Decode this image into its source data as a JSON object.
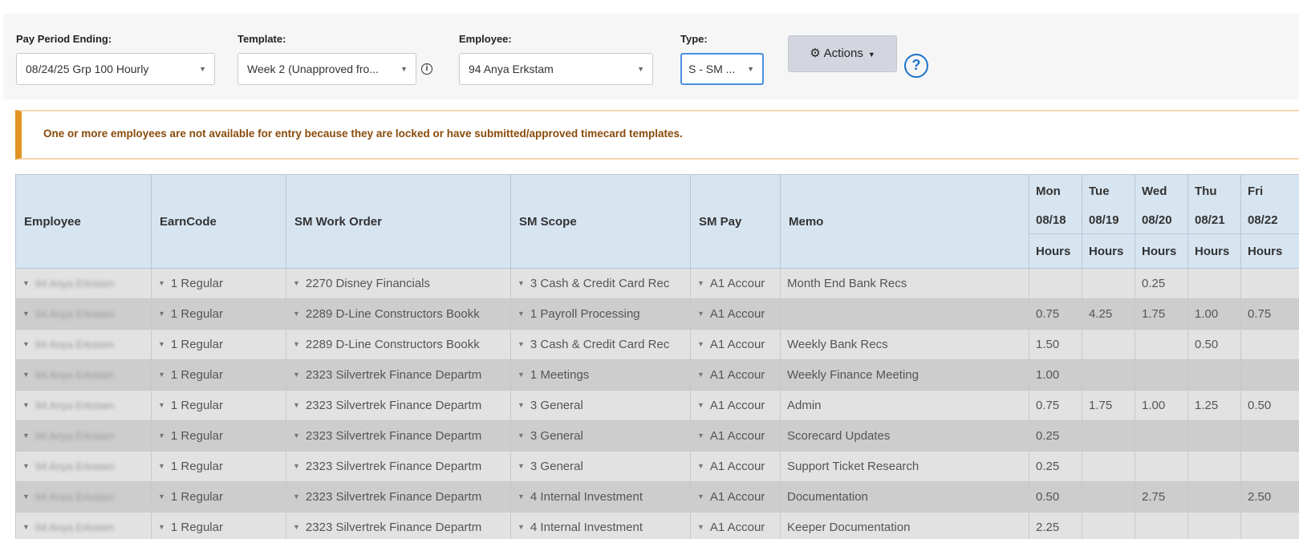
{
  "filters": {
    "pay_period": {
      "label": "Pay Period Ending:",
      "value": "08/24/25 Grp 100 Hourly"
    },
    "template": {
      "label": "Template:",
      "value": "Week 2 (Unapproved fro..."
    },
    "employee": {
      "label": "Employee:",
      "value": "94 Anya Erkstam"
    },
    "type": {
      "label": "Type:",
      "value": "S - SM ..."
    },
    "actions_label": "Actions",
    "help_icon": "help-circle-icon",
    "info_icon": "info-circle-icon"
  },
  "alert": {
    "message": "One or more employees are not available for entry because they are locked or have submitted/approved timecard templates.",
    "accent_color": "#e39321"
  },
  "grid": {
    "headers": {
      "employee": "Employee",
      "earncode": "EarnCode",
      "work_order": "SM Work Order",
      "scope": "SM Scope",
      "pay": "SM Pay",
      "memo": "Memo",
      "hours": "Hours"
    },
    "days": [
      {
        "day": "Mon",
        "date": "08/18"
      },
      {
        "day": "Tue",
        "date": "08/19"
      },
      {
        "day": "Wed",
        "date": "08/20"
      },
      {
        "day": "Thu",
        "date": "08/21"
      },
      {
        "day": "Fri",
        "date": "08/22"
      }
    ],
    "rows": [
      {
        "employee": "94 Anya Erkstam",
        "earncode": "1 Regular",
        "work_order": "2270 Disney Financials",
        "scope": "3 Cash & Credit Card Rec",
        "pay": "A1 Accour",
        "memo": "Month End Bank Recs",
        "hours": [
          "",
          "",
          "0.25",
          "",
          ""
        ]
      },
      {
        "employee": "94 Anya Erkstam",
        "earncode": "1 Regular",
        "work_order": "2289 D-Line Constructors Bookk",
        "scope": "1 Payroll Processing",
        "pay": "A1 Accour",
        "memo": "",
        "hours": [
          "0.75",
          "4.25",
          "1.75",
          "1.00",
          "0.75"
        ]
      },
      {
        "employee": "94 Anya Erkstam",
        "earncode": "1 Regular",
        "work_order": "2289 D-Line Constructors Bookk",
        "scope": "3 Cash & Credit Card Rec",
        "pay": "A1 Accour",
        "memo": "Weekly Bank Recs",
        "hours": [
          "1.50",
          "",
          "",
          "0.50",
          ""
        ]
      },
      {
        "employee": "94 Anya Erkstam",
        "earncode": "1 Regular",
        "work_order": "2323 Silvertrek Finance Departm",
        "scope": "1 Meetings",
        "pay": "A1 Accour",
        "memo": "Weekly Finance Meeting",
        "hours": [
          "1.00",
          "",
          "",
          "",
          ""
        ]
      },
      {
        "employee": "94 Anya Erkstam",
        "earncode": "1 Regular",
        "work_order": "2323 Silvertrek Finance Departm",
        "scope": "3 General",
        "pay": "A1 Accour",
        "memo": "Admin",
        "hours": [
          "0.75",
          "1.75",
          "1.00",
          "1.25",
          "0.50"
        ]
      },
      {
        "employee": "94 Anya Erkstam",
        "earncode": "1 Regular",
        "work_order": "2323 Silvertrek Finance Departm",
        "scope": "3 General",
        "pay": "A1 Accour",
        "memo": "Scorecard Updates",
        "hours": [
          "0.25",
          "",
          "",
          "",
          ""
        ]
      },
      {
        "employee": "94 Anya Erkstam",
        "earncode": "1 Regular",
        "work_order": "2323 Silvertrek Finance Departm",
        "scope": "3 General",
        "pay": "A1 Accour",
        "memo": "Support Ticket Research",
        "hours": [
          "0.25",
          "",
          "",
          "",
          ""
        ]
      },
      {
        "employee": "94 Anya Erkstam",
        "earncode": "1 Regular",
        "work_order": "2323 Silvertrek Finance Departm",
        "scope": "4 Internal Investment",
        "pay": "A1 Accour",
        "memo": "Documentation",
        "hours": [
          "0.50",
          "",
          "2.75",
          "",
          "2.50"
        ]
      },
      {
        "employee": "94 Anya Erkstam",
        "earncode": "1 Regular",
        "work_order": "2323 Silvertrek Finance Departm",
        "scope": "4 Internal Investment",
        "pay": "A1 Accour",
        "memo": "Keeper Documentation",
        "hours": [
          "2.25",
          "",
          "",
          "",
          ""
        ]
      }
    ]
  }
}
